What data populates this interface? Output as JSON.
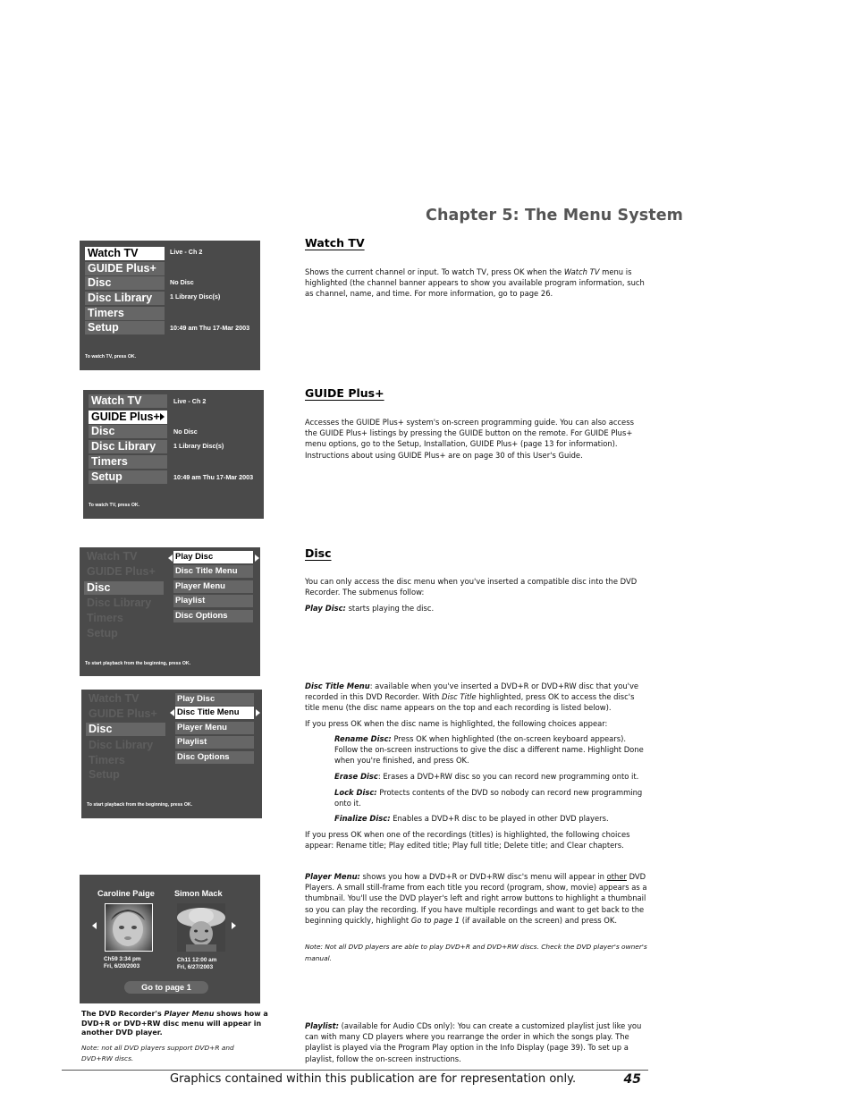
{
  "chapter_title": "Chapter 5: The Menu System",
  "main_menu_items": [
    "Watch TV",
    "GUIDE Plus+",
    "Disc",
    "Disc Library",
    "Timers",
    "Setup"
  ],
  "status_info": {
    "live": "Live - Ch 2",
    "disc": "No Disc",
    "library": "1 Library Disc(s)",
    "datetime": "10:49 am Thu 17-Mar 2003"
  },
  "hints": {
    "watch_tv": "To watch TV, press OK.",
    "play_disc": "To start playback from the beginning, press OK."
  },
  "disc_submenu": [
    "Play Disc",
    "Disc Title Menu",
    "Player Menu",
    "Playlist",
    "Disc Options"
  ],
  "screens": {
    "watch_tv": {
      "selected": "Watch TV"
    },
    "guide_plus": {
      "selected": "GUIDE Plus+"
    },
    "disc_play": {
      "selected": "Disc",
      "sub_selected": "Play Disc"
    },
    "disc_title": {
      "selected": "Disc",
      "sub_selected": "Disc Title Menu"
    }
  },
  "player_menu": {
    "titles": [
      {
        "name": "Caroline Paige",
        "line1": "Ch59 3:34 pm",
        "line2": "Fri, 6/20/2003",
        "thumbnail": "baby-face-photo",
        "selected": true
      },
      {
        "name": "Simon Mack",
        "line1": "Ch11 12:00 am",
        "line2": "Fri, 6/27/2003",
        "thumbnail": "child-in-hat-photo",
        "selected": false
      }
    ],
    "goto_label": "Go to page 1"
  },
  "caption": {
    "main_pre": "The DVD Recorder's ",
    "main_em": "Player Menu",
    "main_post": " shows how a DVD+R or DVD+RW disc menu will appear in another DVD player.",
    "note": "Note: not all DVD players support DVD+R and DVD+RW discs."
  },
  "sections": {
    "watch_tv": {
      "heading": "Watch TV",
      "p1_a": "Shows the current channel or input. To watch TV, press OK when the ",
      "p1_em": "Watch TV",
      "p1_b": " menu is highlighted (the channel banner appears to show you available program information, such as channel, name, and time. For more information, go to page 26."
    },
    "guide_plus": {
      "heading": "GUIDE Plus+",
      "p1": "Accesses the GUIDE Plus+ system's on-screen programming guide. You can also access the GUIDE Plus+ listings by pressing the GUIDE button on the remote. For GUIDE Plus+ menu options, go to the Setup, Installation, GUIDE Plus+ (page 13 for information). Instructions about using GUIDE Plus+ are on page 30 of this User's Guide."
    },
    "disc": {
      "heading": "Disc",
      "intro": "You can only access the disc menu when you've inserted a compatible disc into the DVD Recorder. The submenus follow:",
      "play_disc_term": "Play Disc:",
      "play_disc_text": " starts playing the disc.",
      "title_menu_term": "Disc Title Menu",
      "title_menu_a": ": available when you've inserted a DVD+R or DVD+RW disc that you've recorded in this DVD Recorder. With ",
      "title_menu_em": "Disc Title",
      "title_menu_b": " highlighted, press OK to access the disc's title menu (the disc name appears on the top and each recording is listed below).",
      "disc_name_intro": "If you press OK when the disc name is highlighted, the following choices appear:",
      "choices": [
        {
          "term": "Rename Disc:",
          "text": " Press OK when highlighted (the on-screen keyboard appears). Follow the on-screen instructions to give the disc a different name. Highlight Done when you're finished, and press OK."
        },
        {
          "term": "Erase Disc",
          "text": ": Erases a DVD+RW disc so you can record new programming onto it."
        },
        {
          "term": "Lock Disc:",
          "text": " Protects contents of the DVD so nobody can record new programming onto it."
        },
        {
          "term": "Finalize Disc:",
          "text": " Enables a DVD+R disc to be played in other DVD players."
        }
      ],
      "titles_intro": "If you press OK when one of the recordings (titles) is highlighted, the following choices appear: Rename title; Play edited title; Play full title; Delete title; and Clear chapters.",
      "player_menu_term": "Player Menu:",
      "player_menu_a": "  shows you how a DVD+R or DVD+RW disc's menu will appear in ",
      "player_menu_u": "other",
      "player_menu_b": " DVD Players. A small still-frame from each title you record (program, show, movie) appears as a thumbnail. You'll use the DVD player's left and right arrow buttons to highlight a thumbnail so you can play the recording. If you have multiple recordings and want to get back to the beginning quickly, highlight ",
      "player_menu_em": "Go to page 1",
      "player_menu_c": "  (if available on the screen) and press OK.",
      "player_menu_note": "Note: Not all DVD players are able to play DVD+R and DVD+RW discs. Check the DVD player's owner's manual.",
      "playlist_term": "Playlist:",
      "playlist_text": "  (available for Audio CDs only): You can create a customized playlist just like you can with many CD players where you rearrange the order in which the songs play. The playlist is played via the Program Play option in the Info Display (page 39). To set up a playlist, follow the on-screen instructions."
    }
  },
  "footer": {
    "text": "Graphics contained within this publication are for representation only.",
    "page_number": "45"
  }
}
